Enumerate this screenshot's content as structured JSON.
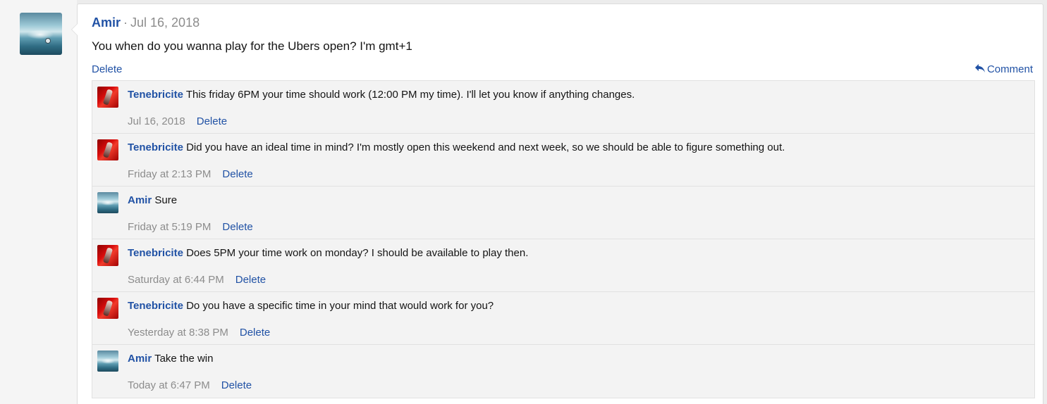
{
  "post": {
    "author": "Amir",
    "separator": "·",
    "date": "Jul 16, 2018",
    "message": "You when do you wanna play for the Ubers open? I'm gmt+1",
    "delete_label": "Delete",
    "comment_label": "Comment",
    "avatar_icon": "amir-avatar-image",
    "comment_icon": "reply-arrow-icon"
  },
  "comments": [
    {
      "author": "Tenebricite",
      "text": "This friday 6PM your time should work (12:00 PM my time). I'll let you know if anything changes.",
      "date": "Jul 16, 2018",
      "delete_label": "Delete",
      "avatar": "red"
    },
    {
      "author": "Tenebricite",
      "text": "Did you have an ideal time in mind? I'm mostly open this weekend and next week, so we should be able to figure something out.",
      "date": "Friday at 2:13 PM",
      "delete_label": "Delete",
      "avatar": "red"
    },
    {
      "author": "Amir",
      "text": "Sure",
      "date": "Friday at 5:19 PM",
      "delete_label": "Delete",
      "avatar": "blue"
    },
    {
      "author": "Tenebricite",
      "text": "Does 5PM your time work on monday? I should be available to play then.",
      "date": "Saturday at 6:44 PM",
      "delete_label": "Delete",
      "avatar": "red"
    },
    {
      "author": "Tenebricite",
      "text": "Do you have a specific time in your mind that would work for you?",
      "date": "Yesterday at 8:38 PM",
      "delete_label": "Delete",
      "avatar": "red"
    },
    {
      "author": "Amir",
      "text": "Take the win",
      "date": "Today at 6:47 PM",
      "delete_label": "Delete",
      "avatar": "blue"
    }
  ],
  "colors": {
    "link": "#2152a5",
    "muted": "#8c8c8c",
    "comment_bg": "#f3f3f3"
  }
}
